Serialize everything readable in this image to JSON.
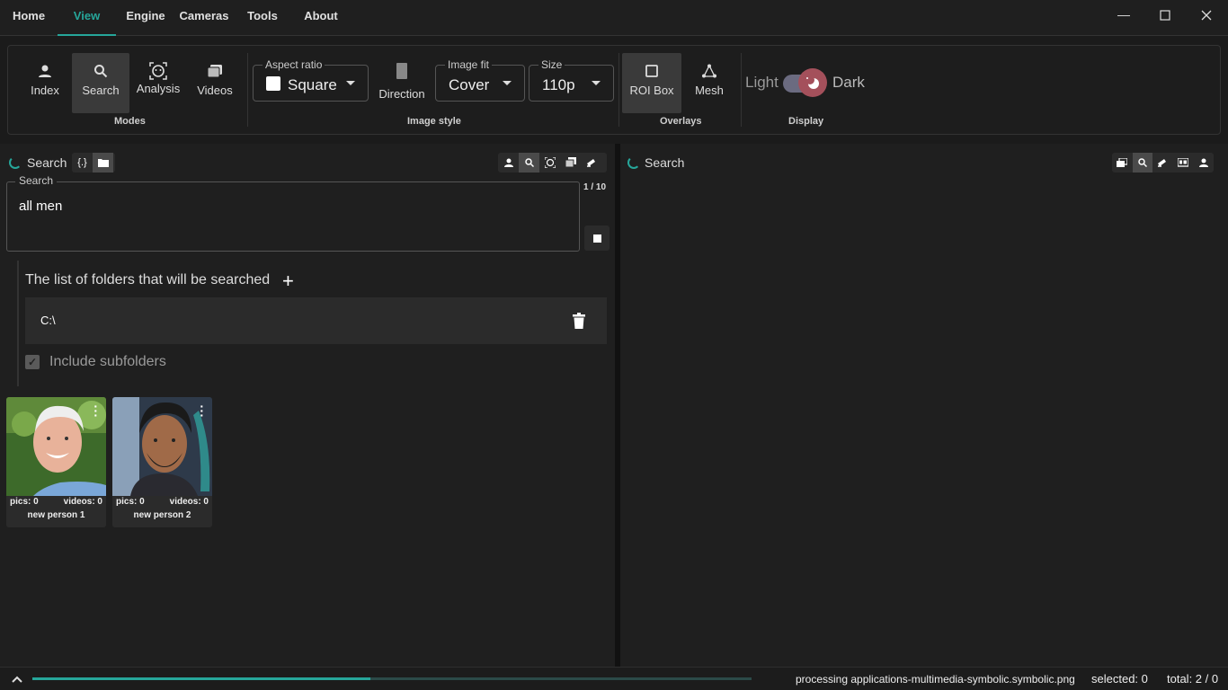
{
  "menu": {
    "tabs": [
      {
        "label": "Home"
      },
      {
        "label": "View"
      },
      {
        "label": "Engine"
      },
      {
        "label": "Cameras"
      },
      {
        "label": "Tools"
      },
      {
        "label": "About"
      }
    ],
    "active": "View"
  },
  "ribbon": {
    "modes": {
      "group_label": "Modes",
      "items": [
        {
          "label": "Index",
          "icon": "person-icon"
        },
        {
          "label": "Search",
          "icon": "search-icon",
          "active": true
        },
        {
          "label": "Analysis",
          "icon": "face-scan-icon"
        },
        {
          "label": "Videos",
          "icon": "videos-icon"
        }
      ]
    },
    "image_style": {
      "group_label": "Image style",
      "aspect_ratio": {
        "legend": "Aspect ratio",
        "value": "Square"
      },
      "direction": {
        "label": "Direction"
      },
      "image_fit": {
        "legend": "Image fit",
        "value": "Cover"
      },
      "size": {
        "legend": "Size",
        "value": "110p"
      }
    },
    "overlays": {
      "group_label": "Overlays",
      "roi_box": {
        "label": "ROI Box",
        "active": true
      },
      "mesh": {
        "label": "Mesh"
      }
    },
    "display": {
      "group_label": "Display",
      "light": "Light",
      "dark": "Dark",
      "mode": "dark"
    }
  },
  "left_pane": {
    "title": "Search",
    "search_field": {
      "legend": "Search",
      "value": "all men"
    },
    "counter": "1 / 10",
    "folders": {
      "title": "The list of folders that will be searched",
      "items": [
        {
          "path": "C:\\"
        }
      ],
      "include_subfolders": {
        "label": "Include subfolders",
        "checked": true
      }
    },
    "results": [
      {
        "pics": "pics: 0",
        "videos": "videos: 0",
        "name": "new person 1"
      },
      {
        "pics": "pics: 0",
        "videos": "videos: 0",
        "name": "new person 2"
      }
    ]
  },
  "right_pane": {
    "title": "Search"
  },
  "status": {
    "text": "processing applications-multimedia-symbolic.symbolic.png",
    "selected": "selected: 0",
    "total": "total: 2 / 0",
    "progress_fraction": 0.47
  },
  "colors": {
    "accent": "#26a69a",
    "toggle_knob": "#a4505b",
    "background": "#1f1f1f"
  }
}
